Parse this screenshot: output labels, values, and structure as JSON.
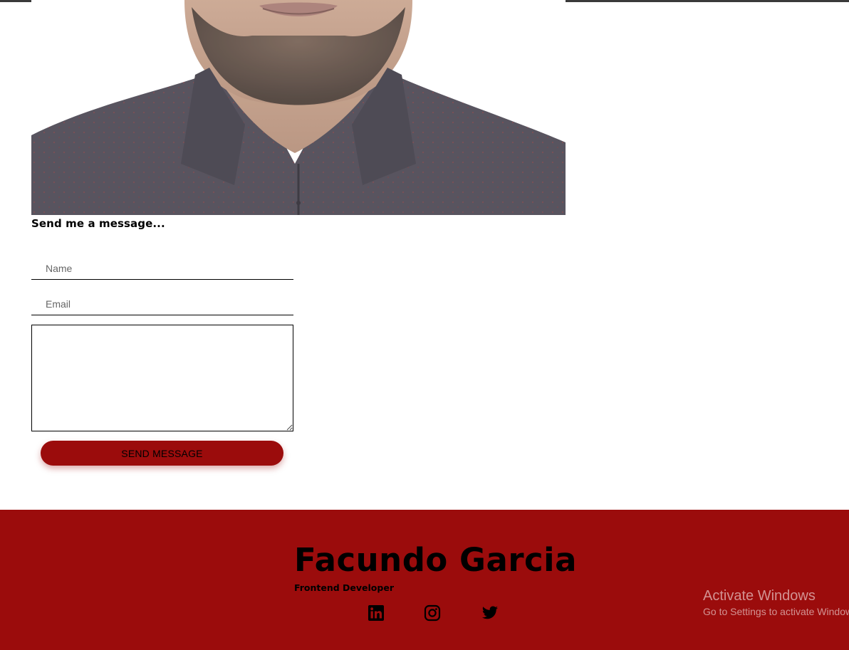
{
  "colors": {
    "accent": "#9b0c0c",
    "footer_background": "#9b0c0c",
    "text": "#000000",
    "watermark": "#d9a3a3"
  },
  "photo": {
    "description_icon": "portrait-photo"
  },
  "contact": {
    "heading": "Send me a message...",
    "name_placeholder": "Name",
    "email_placeholder": "Email",
    "message_value": "",
    "send_label": "SEND MESSAGE"
  },
  "footer": {
    "name": "Facundo Garcia",
    "role": "Frontend Developer",
    "social": [
      {
        "icon": "linkedin-icon"
      },
      {
        "icon": "instagram-icon"
      },
      {
        "icon": "twitter-icon"
      }
    ]
  },
  "watermark": {
    "title": "Activate Windows",
    "subtitle": "Go to Settings to activate Windows."
  }
}
